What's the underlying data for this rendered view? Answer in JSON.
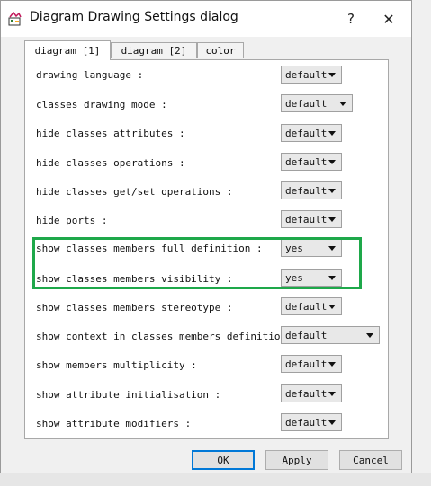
{
  "window": {
    "title": "Diagram Drawing Settings dialog",
    "help_label": "?",
    "close_label": "✕"
  },
  "tabs": [
    {
      "label": "diagram [1]",
      "active": true
    },
    {
      "label": "diagram [2]",
      "active": false
    },
    {
      "label": "color",
      "active": false
    }
  ],
  "settings": [
    {
      "label": "drawing language :",
      "value": "default"
    },
    {
      "label": "classes drawing mode :",
      "value": "default"
    },
    {
      "label": "hide classes attributes :",
      "value": "default"
    },
    {
      "label": "hide classes operations :",
      "value": "default"
    },
    {
      "label": "hide classes get/set operations :",
      "value": "default"
    },
    {
      "label": "hide ports :",
      "value": "default"
    },
    {
      "label": "show classes members full definition :",
      "value": "yes"
    },
    {
      "label": "show classes members visibility :",
      "value": "yes"
    },
    {
      "label": "show classes members stereotype :",
      "value": "default"
    },
    {
      "label": "show context in classes members definition :",
      "value": "default"
    },
    {
      "label": "show members multiplicity :",
      "value": "default"
    },
    {
      "label": "show attribute initialisation :",
      "value": "default"
    },
    {
      "label": "show attribute modifiers :",
      "value": "default"
    }
  ],
  "buttons": {
    "ok": "OK",
    "apply": "Apply",
    "cancel": "Cancel"
  },
  "colors": {
    "highlight": "#1ea84a",
    "default_button_border": "#0078d7"
  }
}
